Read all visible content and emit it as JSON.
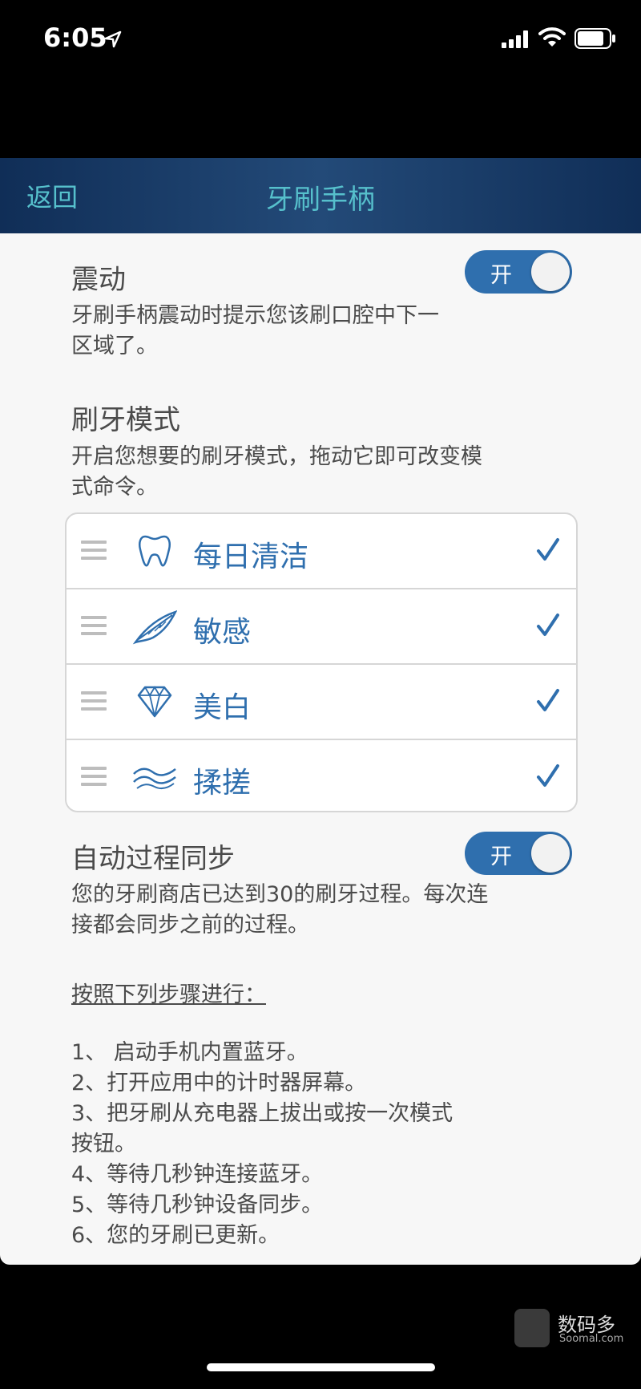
{
  "status_bar": {
    "time": "6:05",
    "icons": [
      "location-arrow-icon",
      "cellular-signal-icon",
      "wifi-icon",
      "battery-icon"
    ]
  },
  "nav": {
    "back_label": "返回",
    "title": "牙刷手柄"
  },
  "vibration": {
    "title": "震动",
    "toggle_label": "开",
    "toggle_on": true,
    "desc_line1": "牙刷手柄震动时提示您该刷口腔中下一",
    "desc_line2": "区域了。"
  },
  "brush_mode": {
    "title": "刷牙模式",
    "desc_line1": "开启您想要的刷牙模式，拖动它即可改变模",
    "desc_line2": "式命令。",
    "modes": [
      {
        "label": "每日清洁",
        "icon": "tooth-icon",
        "checked": true
      },
      {
        "label": "敏感",
        "icon": "feather-icon",
        "checked": true
      },
      {
        "label": "美白",
        "icon": "diamond-icon",
        "checked": true
      },
      {
        "label": "揉搓",
        "icon": "waves-icon",
        "checked": true
      }
    ]
  },
  "auto_sync": {
    "title": "自动过程同步",
    "toggle_label": "开",
    "toggle_on": true,
    "desc_line1": "您的牙刷商店已达到30的刷牙过程。每次连",
    "desc_line2": "接都会同步之前的过程。",
    "steps_heading": "按照下列步骤进行：",
    "steps": [
      "1、 启动手机内置蓝牙。",
      "2、打开应用中的计时器屏幕。",
      "3、把牙刷从充电器上拔出或按一次模式",
      "按钮。",
      "4、等待几秒钟连接蓝牙。",
      "5、等待几秒钟设备同步。",
      "6、您的牙刷已更新。"
    ]
  },
  "watermark": {
    "text": "数码多",
    "sub": "Soomal.com"
  },
  "colors": {
    "accent": "#2f6fae",
    "nav_text": "#56c0cc",
    "nav_bg": "#1a3a66"
  }
}
